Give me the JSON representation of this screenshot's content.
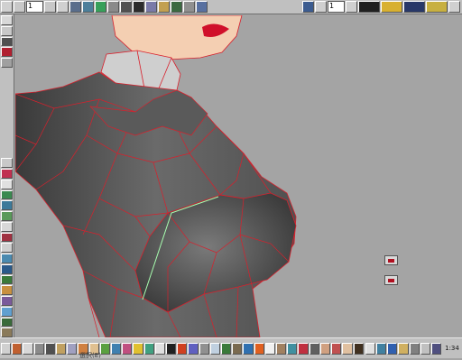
{
  "top_toolbar": {
    "frame_field": "1",
    "frame_field_2": "1",
    "icons": [
      "play-back-icon",
      "step-back-icon",
      "frame-field",
      "step-forward-icon",
      "play-icon",
      "render-icon",
      "display-icon",
      "link-icon",
      "object-icon",
      "grid-icon",
      "camera-icon",
      "light-icon",
      "record-icon",
      "mesh-icon",
      "select-icon",
      "move-icon"
    ]
  },
  "left_toolbar": {
    "icons": [
      "view-icon",
      "scale-icon",
      "chip-icon",
      "layer-icon",
      "bone-icon",
      "paint-icon",
      "smooth-icon",
      "cut-icon",
      "bevel-icon",
      "extrude-icon",
      "weld-icon",
      "material-icon",
      "texture-icon",
      "uv-icon",
      "morph-icon",
      "water-icon",
      "anchor-icon",
      "terrain-icon",
      "landscape-icon"
    ]
  },
  "bottom_toolbar": {
    "status_text": "選択(E)",
    "clock": "1:34"
  },
  "colors": {
    "background": "#a4a4a4",
    "toolbar": "#c0c0c0",
    "mesh_edge": "#d8202c",
    "selected_edge": "#a8ffb0",
    "lips": "#d0102a",
    "skin": "#f6d2b8"
  }
}
